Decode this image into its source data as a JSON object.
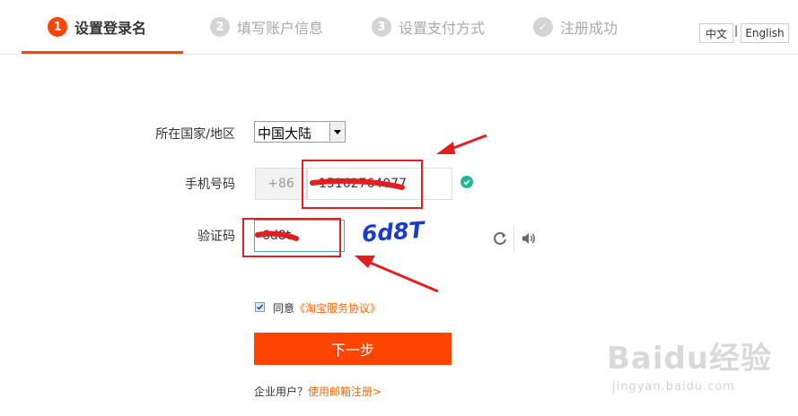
{
  "steps": [
    {
      "num": "1",
      "label": "设置登录名",
      "state": "active"
    },
    {
      "num": "2",
      "label": "填写账户信息",
      "state": "inactive"
    },
    {
      "num": "3",
      "label": "设置支付方式",
      "state": "inactive"
    },
    {
      "num": "✓",
      "label": "注册成功",
      "state": "inactive"
    }
  ],
  "lang": {
    "zh": "中文",
    "sep": "|",
    "en": "English"
  },
  "form": {
    "region_label": "所在国家/地区",
    "region_value": "中国大陆",
    "phone_label": "手机号码",
    "phone_prefix": "+86",
    "phone_value": "15162764077",
    "captcha_label": "验证码",
    "captcha_value": "6d8t",
    "captcha_image_text": "6d8T"
  },
  "agreement": {
    "prefix": "同意",
    "link": "《淘宝服务协议》"
  },
  "next_button": "下一步",
  "corporate": {
    "text": "企业用户？",
    "link": "使用邮箱注册>"
  },
  "watermark": {
    "main": "Baidu经验",
    "sub": "jingyan.baidu.com"
  },
  "colors": {
    "accent": "#ff4400",
    "annotation": "#e02020",
    "success": "#1fb896",
    "link": "#ff6600"
  }
}
